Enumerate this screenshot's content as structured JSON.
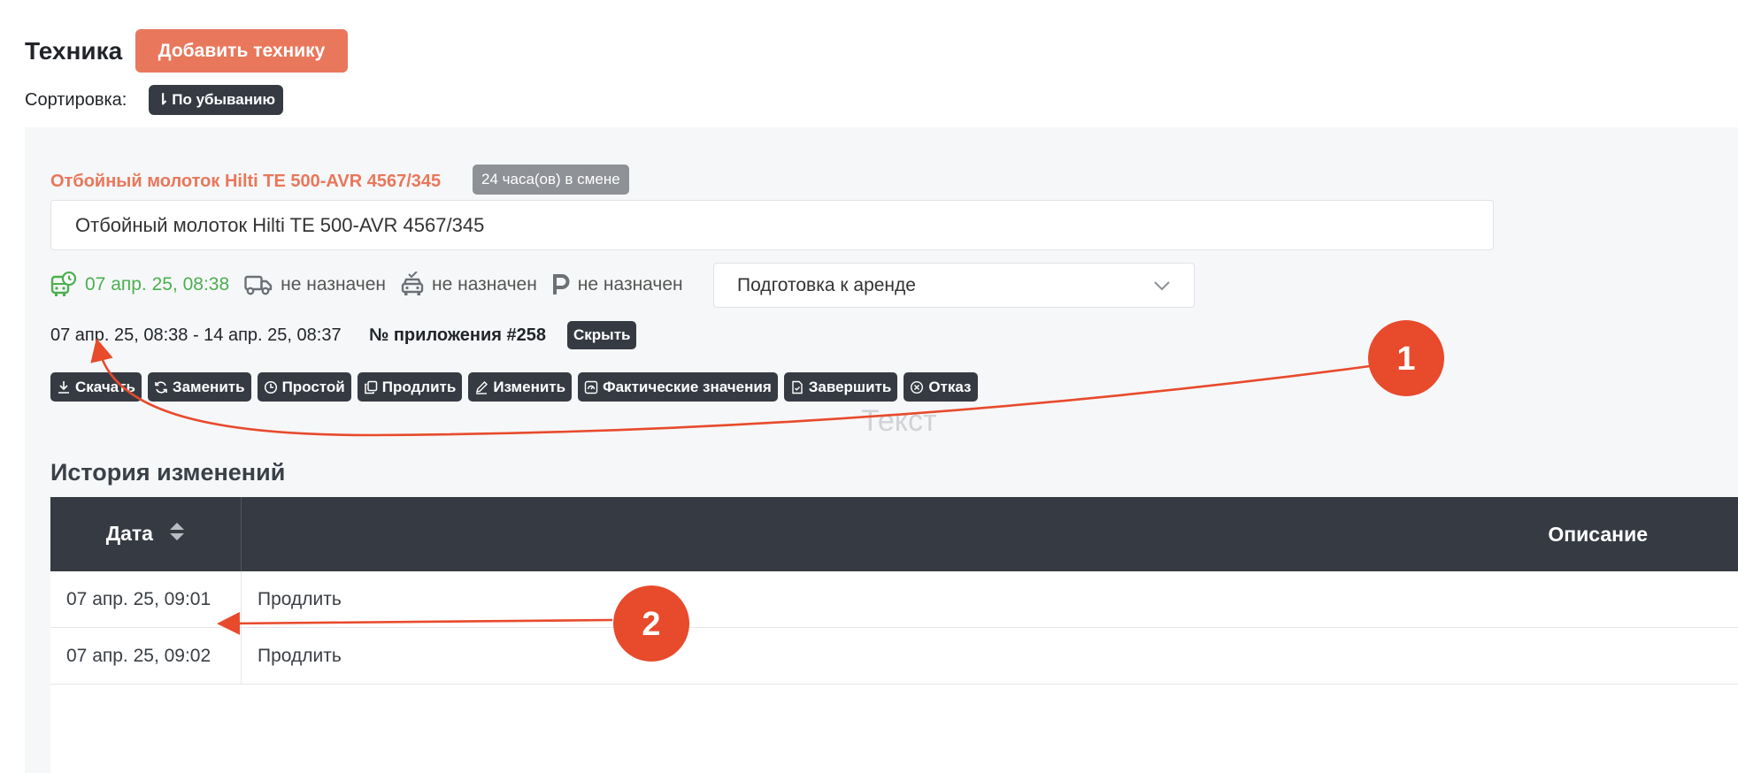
{
  "header": {
    "title": "Техника",
    "add_button": "Добавить технику",
    "sort_label": "Сортировка:",
    "sort_button": "По убыванию"
  },
  "equipment": {
    "title": "Отбойный молоток Hilti TE 500-AVR 4567/345",
    "shift_badge": "24 часа(ов) в смене",
    "name_value": "Отбойный молоток Hilti TE 500-AVR 4567/345",
    "start_time": "07 апр. 25, 08:38",
    "delivery": "не назначен",
    "driver": "не назначен",
    "parking": "не назначен",
    "status": "Подготовка к аренде",
    "period": "07 апр. 25, 08:38 - 14 апр. 25, 08:37",
    "application_no": "№ приложения #258",
    "hide_button": "Скрыть"
  },
  "actions": [
    {
      "label": "Скачать",
      "icon": "download-icon"
    },
    {
      "label": "Заменить",
      "icon": "refresh-icon"
    },
    {
      "label": "Простой",
      "icon": "clock-icon"
    },
    {
      "label": "Продлить",
      "icon": "copy-icon"
    },
    {
      "label": "Изменить",
      "icon": "pencil-icon"
    },
    {
      "label": "Фактические значения",
      "icon": "gauge-icon"
    },
    {
      "label": "Завершить",
      "icon": "document-check-icon"
    },
    {
      "label": "Отказ",
      "icon": "close-circle-icon"
    }
  ],
  "ghost_text": "Текст",
  "history": {
    "title": "История изменений",
    "columns": {
      "date": "Дата",
      "description": "Описание"
    },
    "rows": [
      {
        "date": "07 апр. 25, 09:01",
        "description": "Продлить"
      },
      {
        "date": "07 апр. 25, 09:02",
        "description": "Продлить"
      }
    ]
  },
  "annotations": {
    "marker_1": "1",
    "marker_2": "2"
  },
  "colors": {
    "accent": "#e9775b",
    "dark": "#363b43",
    "success": "#4caf50",
    "annotation": "#e84a2c"
  }
}
